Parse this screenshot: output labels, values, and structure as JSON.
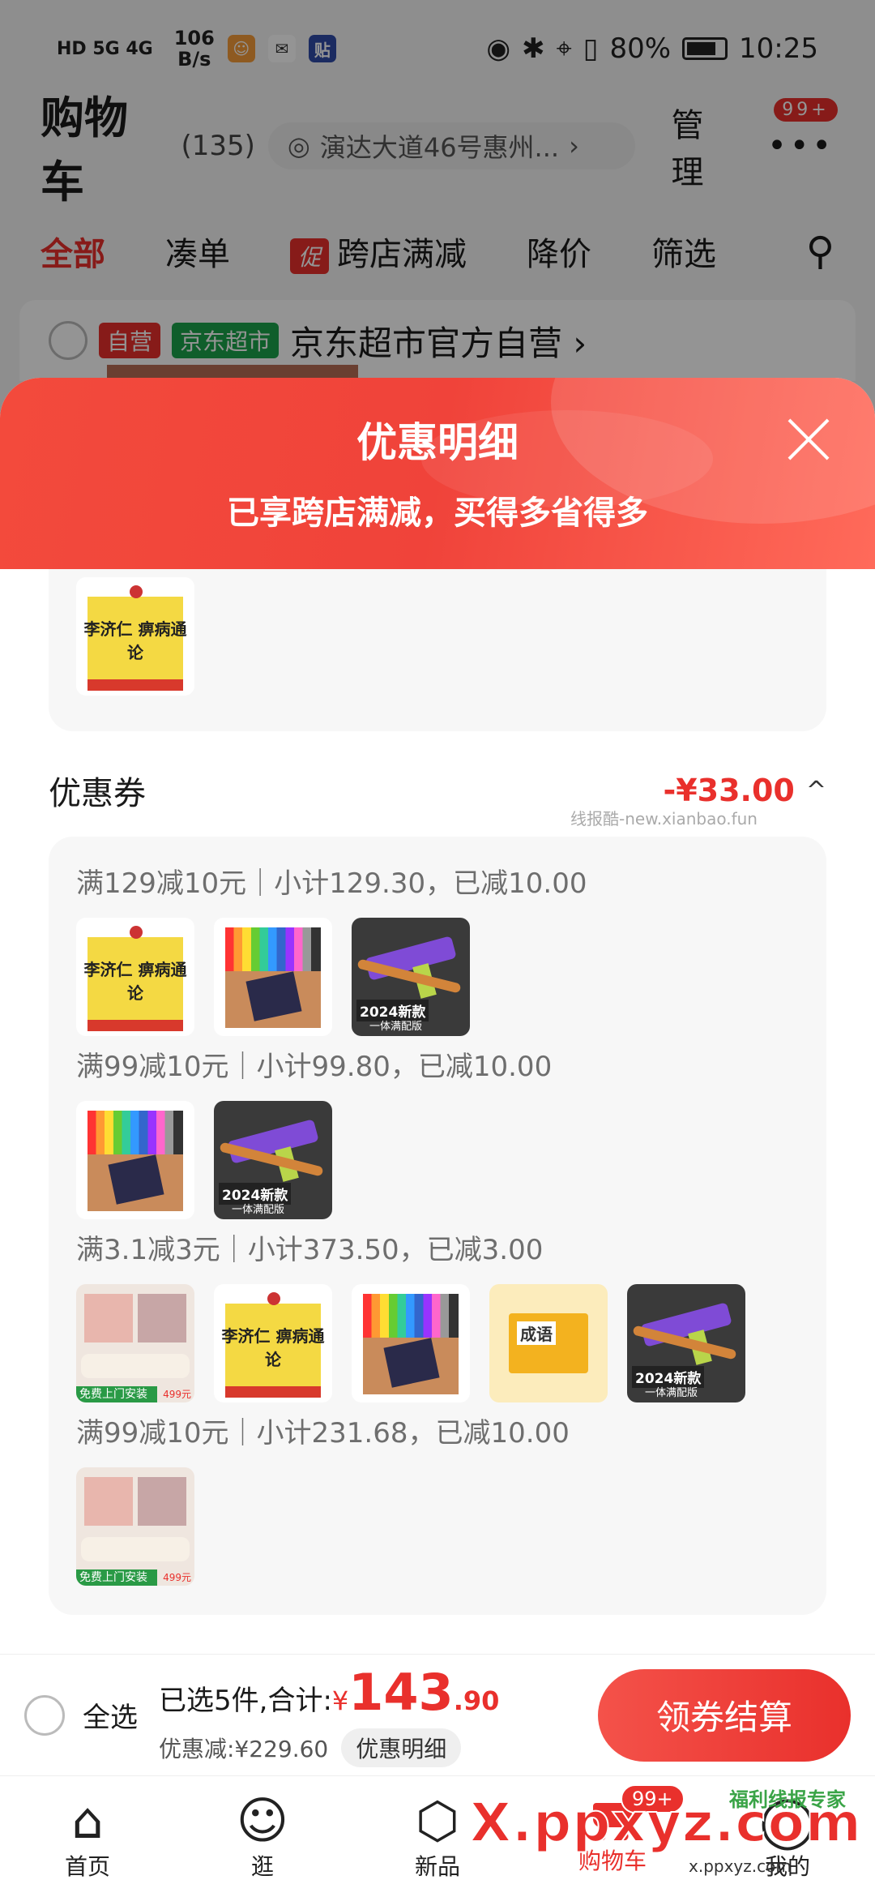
{
  "status_bar": {
    "signal_left": "HD 5G 4G",
    "net_speed": "106\nB/s",
    "battery": "80%",
    "time": "10:25"
  },
  "header": {
    "title": "购物车",
    "count": "(135)",
    "address": "演达大道46号惠州...",
    "manage": "管理",
    "more_badge": "99+"
  },
  "tabs": [
    {
      "label": "全部"
    },
    {
      "label": "凑单"
    },
    {
      "label": "跨店满减",
      "tag": "促"
    },
    {
      "label": "降价"
    },
    {
      "label": "筛选"
    }
  ],
  "store": {
    "tag1": "自营",
    "tag2": "京东超市",
    "name": "京东超市官方自营 ›"
  },
  "sheet": {
    "title": "优惠明细",
    "subtitle": "已享跨店满减，买得多省得多",
    "coupon_section": {
      "title": "优惠券",
      "amount": "-¥33.00",
      "caret": "^"
    },
    "watermark": "线报酷-new.xianbao.fun",
    "groups": [
      {
        "label": "满129减10元｜小计129.30，已减10.00",
        "items": [
          "book",
          "pen",
          "gun"
        ]
      },
      {
        "label": "满99减10元｜小计99.80，已减10.00",
        "items": [
          "pen",
          "gun"
        ]
      },
      {
        "label": "满3.1减3元｜小计373.50，已减3.00",
        "items": [
          "wall",
          "book",
          "pen",
          "chengyu",
          "gun"
        ]
      },
      {
        "label": "满99减10元｜小计231.68，已减10.00",
        "items": [
          "wall"
        ]
      }
    ],
    "thumb_text": {
      "book": "李济仁 痹病通论",
      "gun": "2024新款",
      "gun_sub": "一体满配版",
      "wall": "免费上门安装",
      "wall_price": "499元",
      "chengyu": "成语"
    }
  },
  "checkout": {
    "select_all": "全选",
    "selected_text": "已选5件,合计:",
    "yen": "¥",
    "price_int": "143",
    "price_dec": ".90",
    "discount": "优惠减:¥229.60",
    "detail_btn": "优惠明细",
    "button": "领券结算"
  },
  "nav": [
    {
      "label": "首页",
      "icon": "home-icon"
    },
    {
      "label": "逛",
      "icon": "face-icon"
    },
    {
      "label": "新品",
      "icon": "cube-icon"
    },
    {
      "label": "购物车",
      "icon": "cart-icon",
      "badge": "99+"
    },
    {
      "label": "我的",
      "icon": "user-icon"
    }
  ],
  "watermarks": {
    "big": "X.ppxyz.com",
    "small": "x.ppxyz.com",
    "logo": "福利线报专家"
  },
  "colors": {
    "accent": "#e9302c",
    "green_tag": "#1aa34a"
  }
}
